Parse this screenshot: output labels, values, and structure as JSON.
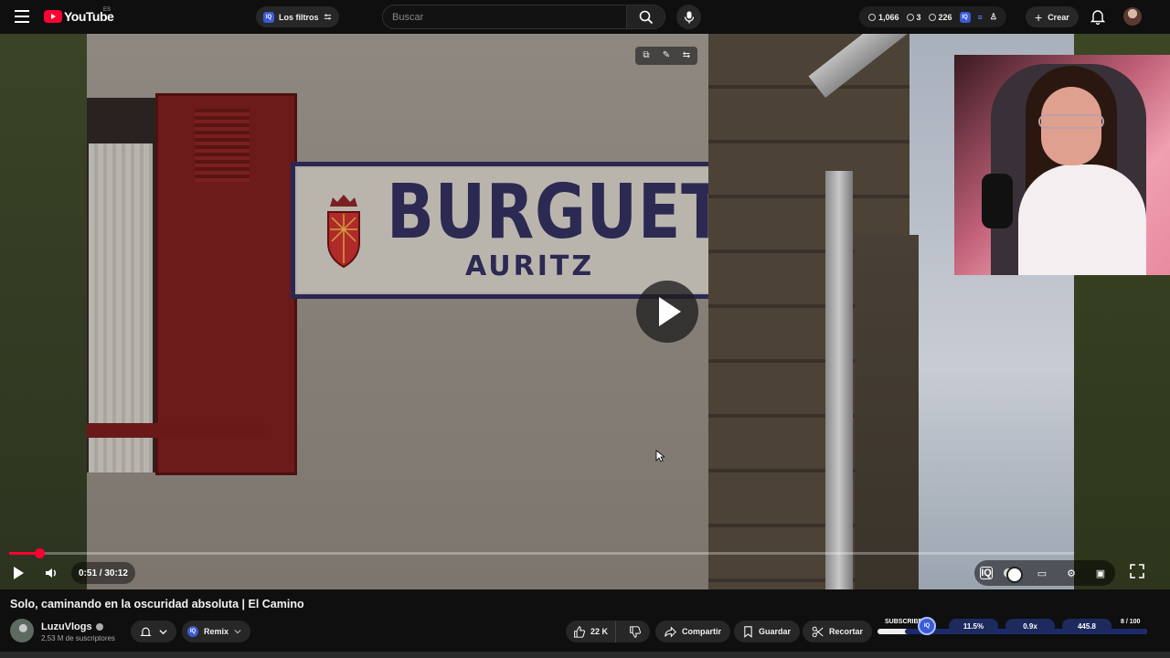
{
  "header": {
    "logo_text": "YouTube",
    "logo_country": "ES",
    "filters_label": "Los filtros",
    "search_placeholder": "Buscar",
    "stats": {
      "views": "1,066",
      "watching": "3",
      "other": "226"
    },
    "create_label": "Crear",
    "icons": [
      "menu-icon",
      "search-icon",
      "mic-icon",
      "bell-icon",
      "plus-icon",
      "eye-icon"
    ]
  },
  "player": {
    "sign_main": "BURGUETE",
    "sign_sub": "AURITZ",
    "time_current": "0:51",
    "time_total": "30:12",
    "time_display": "0:51 / 30:12",
    "progress_fraction": 0.028,
    "accent_color": "#ff0033"
  },
  "video": {
    "title": "Solo, caminando en la oscuridad absoluta | El Camino",
    "channel_name": "LuzuVlogs",
    "channel_subs": "2,53 M de suscriptores",
    "remix_label": "Remix",
    "likes": "22 K",
    "share_label": "Compartir",
    "save_label": "Guardar",
    "clip_label": "Recortar"
  },
  "iq_panel": {
    "label": "SUBSCRIBERS",
    "pct": "11.5%",
    "multiplier": "0.9x",
    "value": "445.8",
    "count": "8 / 100",
    "brand_color": "#3b5bd6"
  }
}
